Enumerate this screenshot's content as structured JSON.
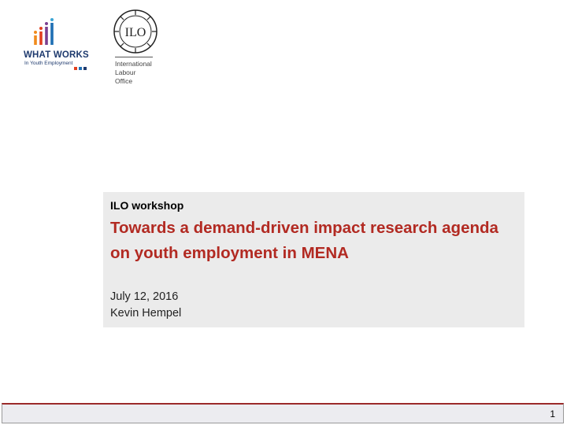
{
  "logos": {
    "whatworks": {
      "title": "WHAT WORKS",
      "subtitle": "In Youth Employment",
      "colors": [
        "#e2401f",
        "#7b3f8f",
        "#1f6fb4",
        "#f08a1c",
        "#3aa5d4"
      ]
    },
    "ilo": {
      "emblem_text": "ILO",
      "lines": [
        "International",
        "Labour",
        "Office"
      ]
    }
  },
  "slide": {
    "kicker": "ILO workshop",
    "title": "Towards a demand-driven impact research agenda on youth employment in MENA",
    "date": "July 12, 2016",
    "author": "Kevin Hempel"
  },
  "footer": {
    "page_number": "1"
  },
  "colors": {
    "title_red": "#b22a22",
    "box_gray": "#ebebeb",
    "footer_rule": "#9b2a2a"
  }
}
